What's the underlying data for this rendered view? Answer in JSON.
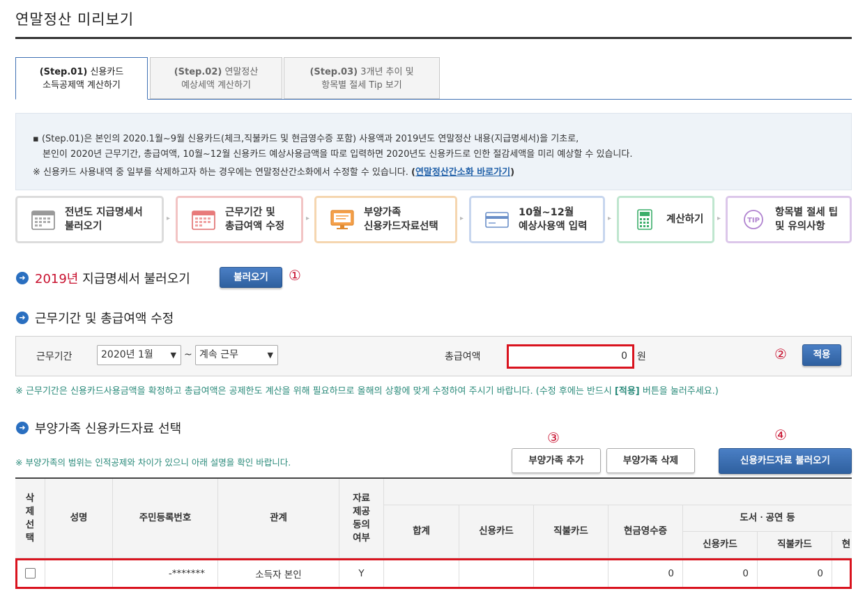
{
  "page": {
    "title": "연말정산 미리보기"
  },
  "tabs": [
    {
      "step": "(Step.01)",
      "line1_rest": " 신용카드",
      "line2": "소득공제액 계산하기",
      "active": true
    },
    {
      "step": "(Step.02)",
      "line1_rest": " 연말정산",
      "line2": "예상세액 계산하기",
      "active": false
    },
    {
      "step": "(Step.03)",
      "line1_rest": " 3개년 추이 및",
      "line2": "항목별 절세 Tip 보기",
      "active": false
    }
  ],
  "info": {
    "line1": "▪ (Step.01)은 본인의 2020.1월~9월 신용카드(체크,직불카드 및 현금영수증 포함) 사용액과 2019년도 연말정산 내용(지급명세서)을 기초로,",
    "line2": "본인이 2020년 근무기간, 총급여액, 10월~12월 신용카드 예상사용금액을 따로 입력하면 2020년도 신용카드로 인한 절감세액을 미리 예상할 수 있습니다.",
    "line3_text": "※ 신용카드 사용내역 중 일부를 삭제하고자 하는 경우에는 연말정산간소화에서 수정할 수 있습니다. ",
    "line3_open": "(",
    "line3_link": "연말정산간소화 바로가기",
    "line3_close": ")"
  },
  "steps": [
    {
      "icon": "calendar-gray-icon",
      "line1": "전년도 지급명세서",
      "line2": "불러오기",
      "border": "#dcdcdc"
    },
    {
      "icon": "calendar-red-icon",
      "line1": "근무기간 및",
      "line2": "총급여액 수정",
      "border": "#f2c4c4"
    },
    {
      "icon": "monitor-orange-icon",
      "line1": "부양가족",
      "line2": "신용카드자료선택",
      "border": "#f5d6b0"
    },
    {
      "icon": "card-blue-icon",
      "line1": "10월~12월",
      "line2": "예상사용액 입력",
      "border": "#c7d6ee"
    },
    {
      "icon": "calculator-green-icon",
      "line1": "계산하기",
      "line2": "",
      "border": "#bfe6cf"
    },
    {
      "icon": "tip-purple-icon",
      "line1": "항목별 절세 팁",
      "line2": "및 유의사항",
      "border": "#dcc7ea"
    }
  ],
  "section1": {
    "year": "2019년",
    "title": " 지급명세서 불러오기",
    "button": "불러오기",
    "marker": "①"
  },
  "section2": {
    "title": "근무기간 및 총급여액 수정",
    "period_label": "근무기간",
    "start_value": "2020년 1월",
    "tilde": "~",
    "end_value": "계속 근무",
    "salary_label": "총급여액",
    "salary_value": "0",
    "unit": "원",
    "marker": "②",
    "apply_button": "적용",
    "note": "※ 근무기간은 신용카드사용금액을 확정하고 총급여액은 공제한도 계산을 위해 필요하므로 올해의 상황에 맞게 수정하여 주시기 바랍니다. (수정 후에는 반드시 ",
    "note_bold": "[적용]",
    "note_end": " 버튼을 눌러주세요.)"
  },
  "section3": {
    "title": "부양가족 신용카드자료 선택",
    "note": "※ 부양가족의 범위는 인적공제와 차이가 있으니 아래 설명을 확인 바랍니다.",
    "marker3": "③",
    "marker4": "④",
    "add_button": "부양가족 추가",
    "delete_button": "부양가족 삭제",
    "load_button": "신용카드자료 불러오기"
  },
  "table": {
    "headers": {
      "delete_select": "삭제선택",
      "name": "성명",
      "rrn": "주민등록번호",
      "relation": "관계",
      "consent": "자료제공동의여부",
      "total": "합계",
      "credit": "신용카드",
      "debit": "직불카드",
      "cash": "현금영수증",
      "books_group": "도서ㆍ공연 등",
      "books_credit": "신용카드",
      "books_debit": "직불카드",
      "books_cash": "현"
    },
    "rows": [
      {
        "name": "",
        "rrn": "-*******",
        "relation": "소득자 본인",
        "consent": "Y",
        "total": "",
        "credit": "",
        "debit": "",
        "cash": "0",
        "books_credit": "0",
        "books_debit": "0"
      }
    ]
  }
}
